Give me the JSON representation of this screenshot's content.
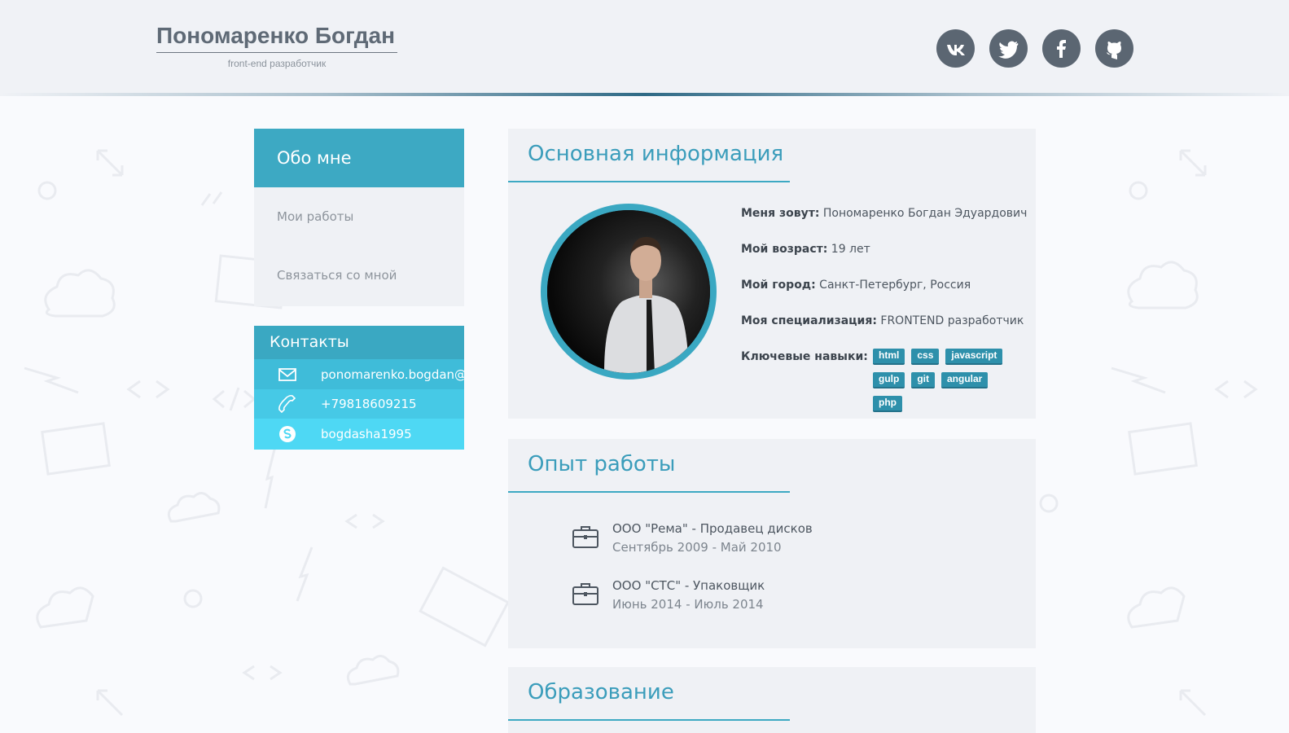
{
  "header": {
    "name": "Пономаренко Богдан",
    "subtitle": "front-end разработчик",
    "socials": [
      {
        "icon": "vk-icon",
        "label": "VK"
      },
      {
        "icon": "twitter-icon",
        "label": "Twitter"
      },
      {
        "icon": "facebook-icon",
        "label": "Facebook"
      },
      {
        "icon": "github-icon",
        "label": "GitHub"
      }
    ]
  },
  "nav": {
    "items": [
      {
        "label": "Обо мне"
      },
      {
        "label": "Мои работы"
      },
      {
        "label": "Связаться со мной"
      }
    ]
  },
  "contacts": {
    "title": "Контакты",
    "items": [
      {
        "icon": "mail-icon",
        "value": "ponomarenko.bogdan@"
      },
      {
        "icon": "phone-icon",
        "value": "+79818609215"
      },
      {
        "icon": "skype-icon",
        "value": "bogdasha1995"
      }
    ]
  },
  "main_info": {
    "title": "Основная информация",
    "rows": [
      {
        "label": "Меня зовут:",
        "value": "Пономаренко Богдан Эдуардович"
      },
      {
        "label": "Мой возраст:",
        "value": "19 лет"
      },
      {
        "label": "Мой город:",
        "value": "Санкт-Петербург, Россия"
      },
      {
        "label": "Моя специализация:",
        "value": "FRONTEND разработчик"
      }
    ],
    "skills_label": "Ключевые навыки:",
    "skills": [
      "html",
      "css",
      "javascript",
      "gulp",
      "git",
      "angular",
      "php"
    ]
  },
  "experience": {
    "title": "Опыт работы",
    "jobs": [
      {
        "title": "ООО \"Рема\" - Продавец дисков",
        "dates": "Сентябрь 2009 - Май 2010"
      },
      {
        "title": "ООО \"СТС\" - Упаковщик",
        "dates": "Июнь 2014 - Июль 2014"
      }
    ]
  },
  "education": {
    "title": "Образование"
  },
  "colors": {
    "accent": "#3da9c3",
    "header_bg": "#f0f2f6",
    "card_bg": "#eff1f5",
    "social_bg": "#5b6672"
  }
}
